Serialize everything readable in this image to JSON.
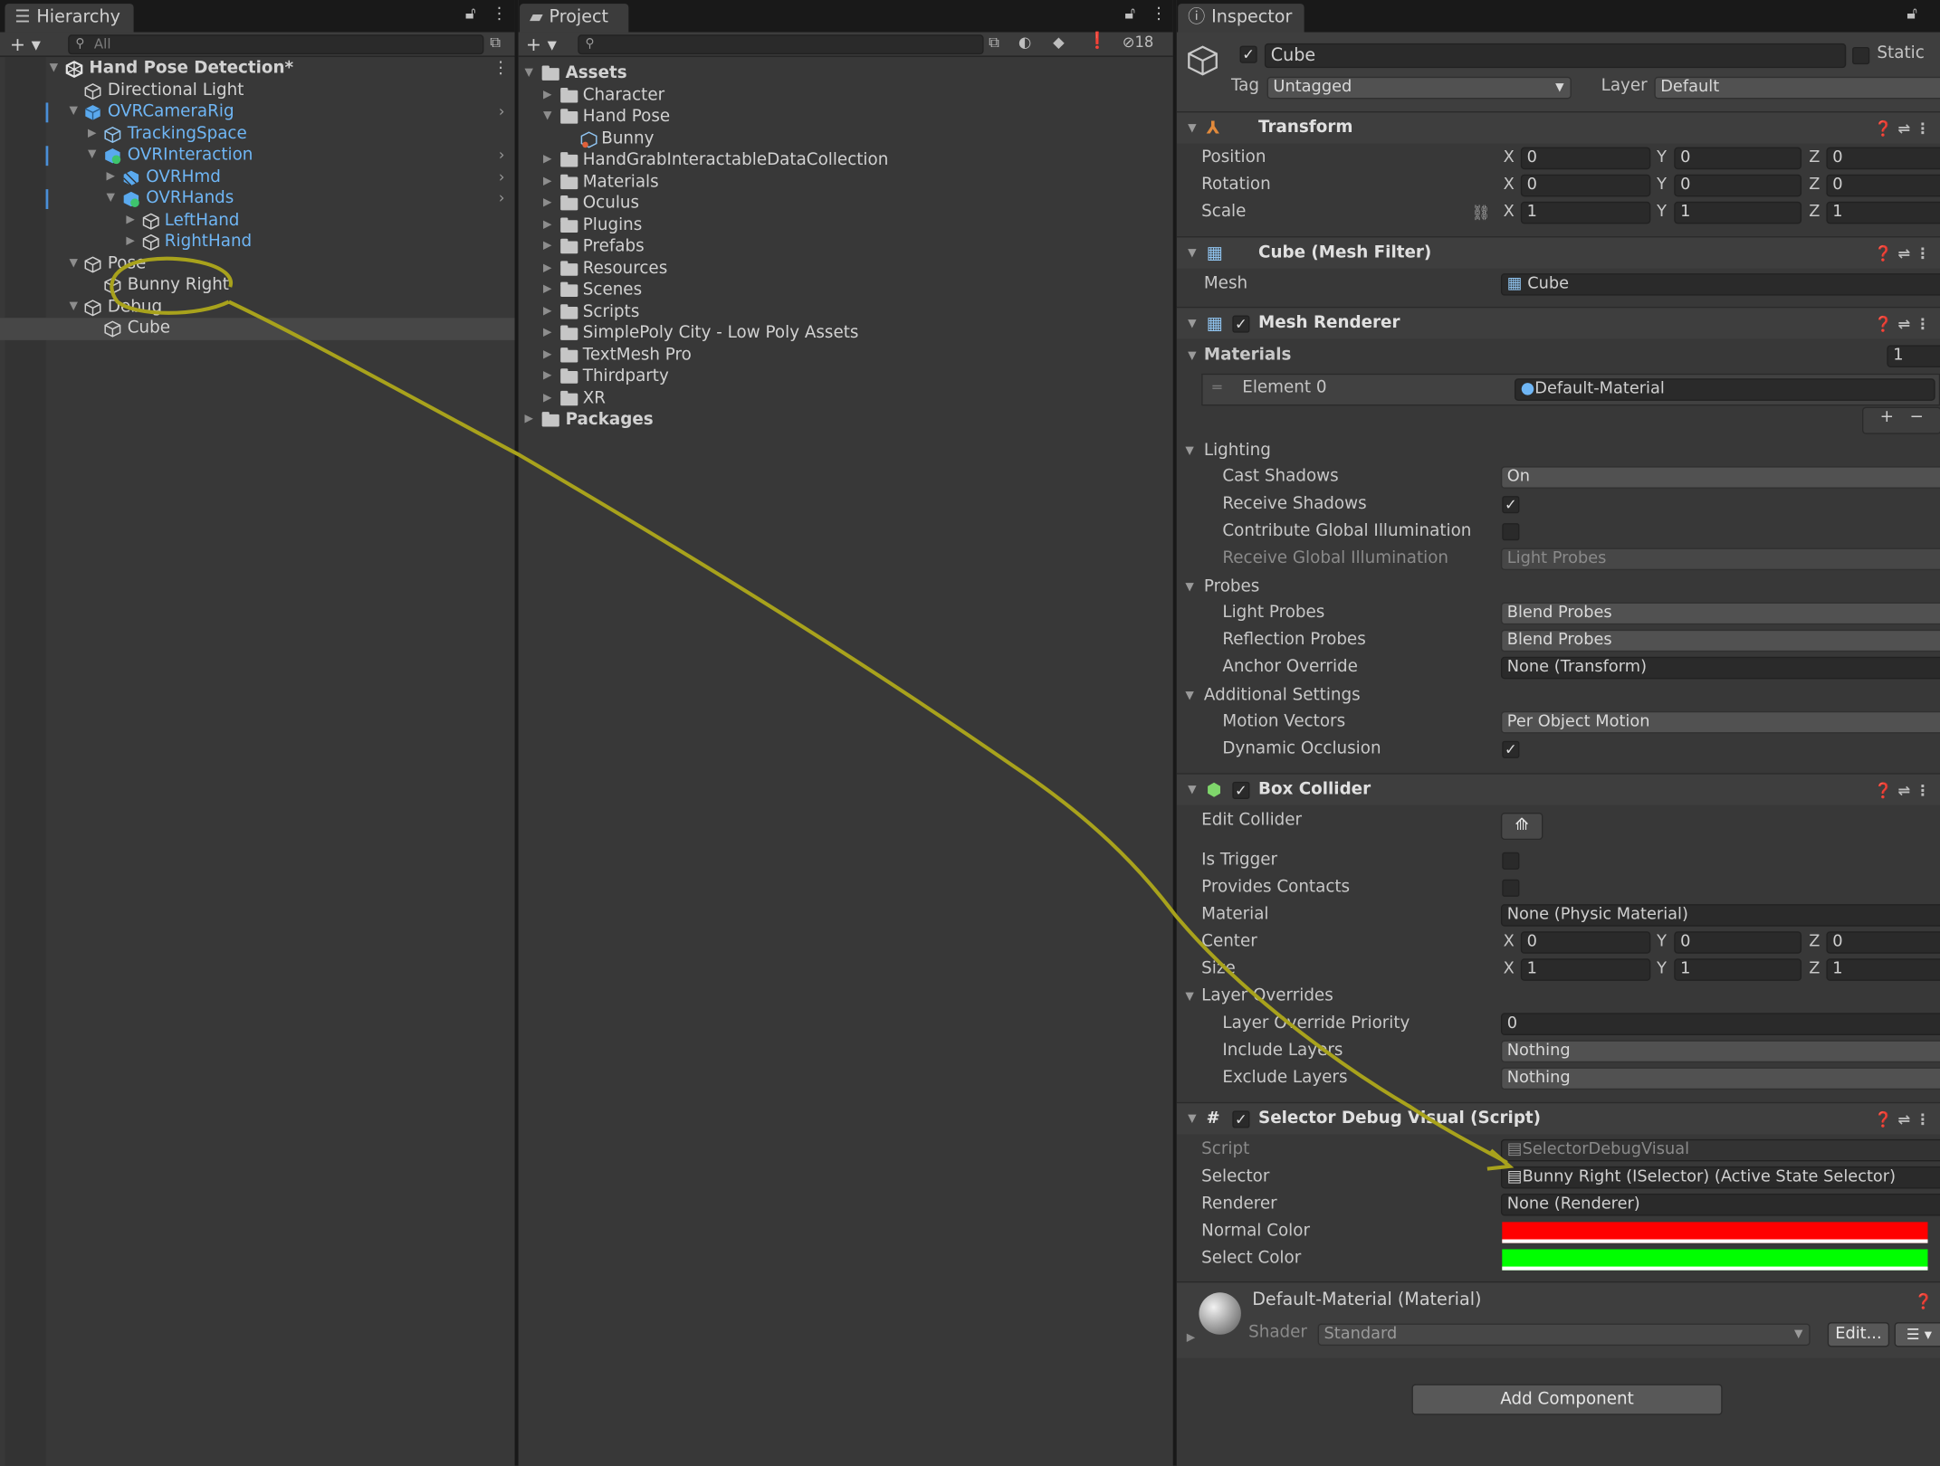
{
  "hierarchy": {
    "tab_label": "Hierarchy",
    "search_placeholder": "All",
    "items": [
      {
        "label": "Hand Pose Detection*"
      },
      {
        "label": "Directional Light"
      },
      {
        "label": "OVRCameraRig"
      },
      {
        "label": "TrackingSpace"
      },
      {
        "label": "OVRInteraction"
      },
      {
        "label": "OVRHmd"
      },
      {
        "label": "OVRHands"
      },
      {
        "label": "LeftHand"
      },
      {
        "label": "RightHand"
      },
      {
        "label": "Pose"
      },
      {
        "label": "Bunny Right"
      },
      {
        "label": "Debug"
      },
      {
        "label": "Cube"
      }
    ]
  },
  "project": {
    "tab_label": "Project",
    "hidden_count": "18",
    "items": [
      {
        "label": "Assets"
      },
      {
        "label": "Character"
      },
      {
        "label": "Hand Pose"
      },
      {
        "label": "Bunny"
      },
      {
        "label": "HandGrabInteractableDataCollection"
      },
      {
        "label": "Materials"
      },
      {
        "label": "Oculus"
      },
      {
        "label": "Plugins"
      },
      {
        "label": "Prefabs"
      },
      {
        "label": "Resources"
      },
      {
        "label": "Scenes"
      },
      {
        "label": "Scripts"
      },
      {
        "label": "SimplePoly City - Low Poly Assets"
      },
      {
        "label": "TextMesh Pro"
      },
      {
        "label": "Thirdparty"
      },
      {
        "label": "XR"
      },
      {
        "label": "Packages"
      }
    ]
  },
  "inspector": {
    "tab_label": "Inspector",
    "object_name": "Cube",
    "static_label": "Static",
    "tag_label": "Tag",
    "tag_value": "Untagged",
    "layer_label": "Layer",
    "layer_value": "Default",
    "transform": {
      "title": "Transform",
      "position_label": "Position",
      "rotation_label": "Rotation",
      "scale_label": "Scale",
      "position": [
        "0",
        "0",
        "0"
      ],
      "rotation": [
        "0",
        "0",
        "0"
      ],
      "scale": [
        "1",
        "1",
        "1"
      ]
    },
    "axis": {
      "x": "X",
      "y": "Y",
      "z": "Z"
    },
    "mesh_filter": {
      "title": "Cube (Mesh Filter)",
      "mesh_label": "Mesh",
      "mesh_value": "Cube"
    },
    "mesh_renderer": {
      "title": "Mesh Renderer",
      "materials_label": "Materials",
      "materials_count": "1",
      "element0_label": "Element 0",
      "element0_value": "Default-Material",
      "lighting_label": "Lighting",
      "cast_shadows_label": "Cast Shadows",
      "cast_shadows_value": "On",
      "receive_shadows_label": "Receive Shadows",
      "contribute_gi_label": "Contribute Global Illumination",
      "receive_gi_label": "Receive Global Illumination",
      "receive_gi_value": "Light Probes",
      "probes_label": "Probes",
      "light_probes_label": "Light Probes",
      "light_probes_value": "Blend Probes",
      "reflection_probes_label": "Reflection Probes",
      "reflection_probes_value": "Blend Probes",
      "anchor_override_label": "Anchor Override",
      "anchor_override_value": "None (Transform)",
      "additional_label": "Additional Settings",
      "motion_vectors_label": "Motion Vectors",
      "motion_vectors_value": "Per Object Motion",
      "dynamic_occlusion_label": "Dynamic Occlusion"
    },
    "box_collider": {
      "title": "Box Collider",
      "edit_collider_label": "Edit Collider",
      "is_trigger_label": "Is Trigger",
      "provides_contacts_label": "Provides Contacts",
      "material_label": "Material",
      "material_value": "None (Physic Material)",
      "center_label": "Center",
      "center": [
        "0",
        "0",
        "0"
      ],
      "size_label": "Size",
      "size": [
        "1",
        "1",
        "1"
      ],
      "layer_overrides_label": "Layer Overrides",
      "priority_label": "Layer Override Priority",
      "priority_value": "0",
      "include_label": "Include Layers",
      "include_value": "Nothing",
      "exclude_label": "Exclude Layers",
      "exclude_value": "Nothing"
    },
    "selector_debug": {
      "title": "Selector Debug Visual (Script)",
      "script_label": "Script",
      "script_value": "SelectorDebugVisual",
      "selector_label": "Selector",
      "selector_value": "Bunny Right (ISelector) (Active State Selector)",
      "renderer_label": "Renderer",
      "renderer_value": "None (Renderer)",
      "normal_color_label": "Normal Color",
      "normal_color": "#ff0000",
      "select_color_label": "Select Color",
      "select_color": "#00ff00"
    },
    "material": {
      "title": "Default-Material (Material)",
      "shader_label": "Shader",
      "shader_value": "Standard",
      "edit_label": "Edit..."
    },
    "add_component_label": "Add Component"
  },
  "annotation_color": "#a8a21c"
}
